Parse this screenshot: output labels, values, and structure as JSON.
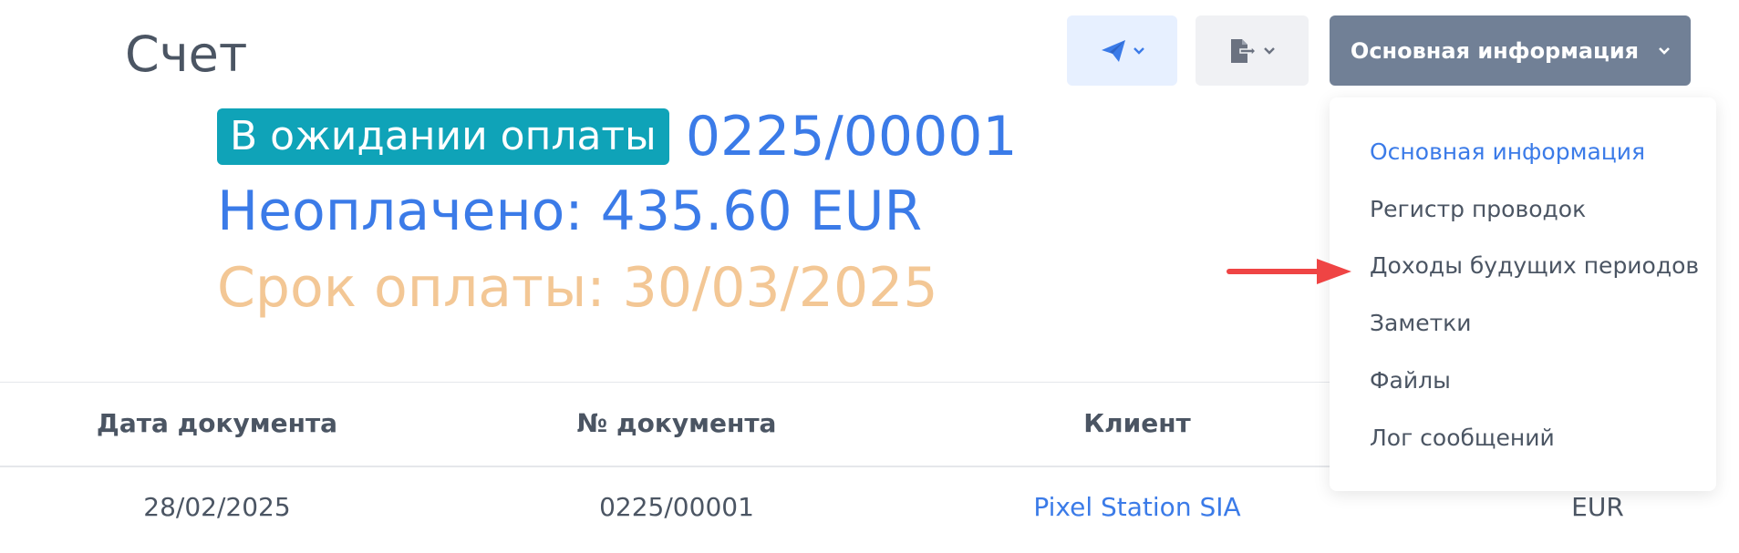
{
  "page": {
    "title": "Счет"
  },
  "toolbar": {
    "send_icon": "paper-plane-icon",
    "export_icon": "file-export-icon",
    "info_button_label": "Основная информация",
    "colors": {
      "send_bg": "#e7f0ff",
      "export_bg": "#f0f1f4",
      "info_bg": "#718096"
    }
  },
  "invoice": {
    "status": "В ожидании оплаты",
    "number": "0225/00001",
    "unpaid": "Неоплачено: 435.60 EUR",
    "due": "Срок оплаты: 30/03/2025",
    "colors": {
      "status_bg": "#0fa3b8",
      "accent": "#3b7be8",
      "due": "#f3c795"
    }
  },
  "table": {
    "headers": [
      "Дата документа",
      "№ документа",
      "Клиент"
    ],
    "row": [
      "28/02/2025",
      "0225/00001",
      "Pixel Station SIA",
      "EUR"
    ]
  },
  "dropdown": {
    "items": [
      {
        "label": "Основная информация",
        "active": true
      },
      {
        "label": "Регистр проводок",
        "active": false
      },
      {
        "label": "Доходы будущих периодов",
        "active": false
      },
      {
        "label": "Заметки",
        "active": false
      },
      {
        "label": "Файлы",
        "active": false
      },
      {
        "label": "Лог сообщений",
        "active": false
      }
    ]
  },
  "annotation": {
    "arrow_icon": "red-arrow-icon",
    "color": "#ef4444"
  }
}
